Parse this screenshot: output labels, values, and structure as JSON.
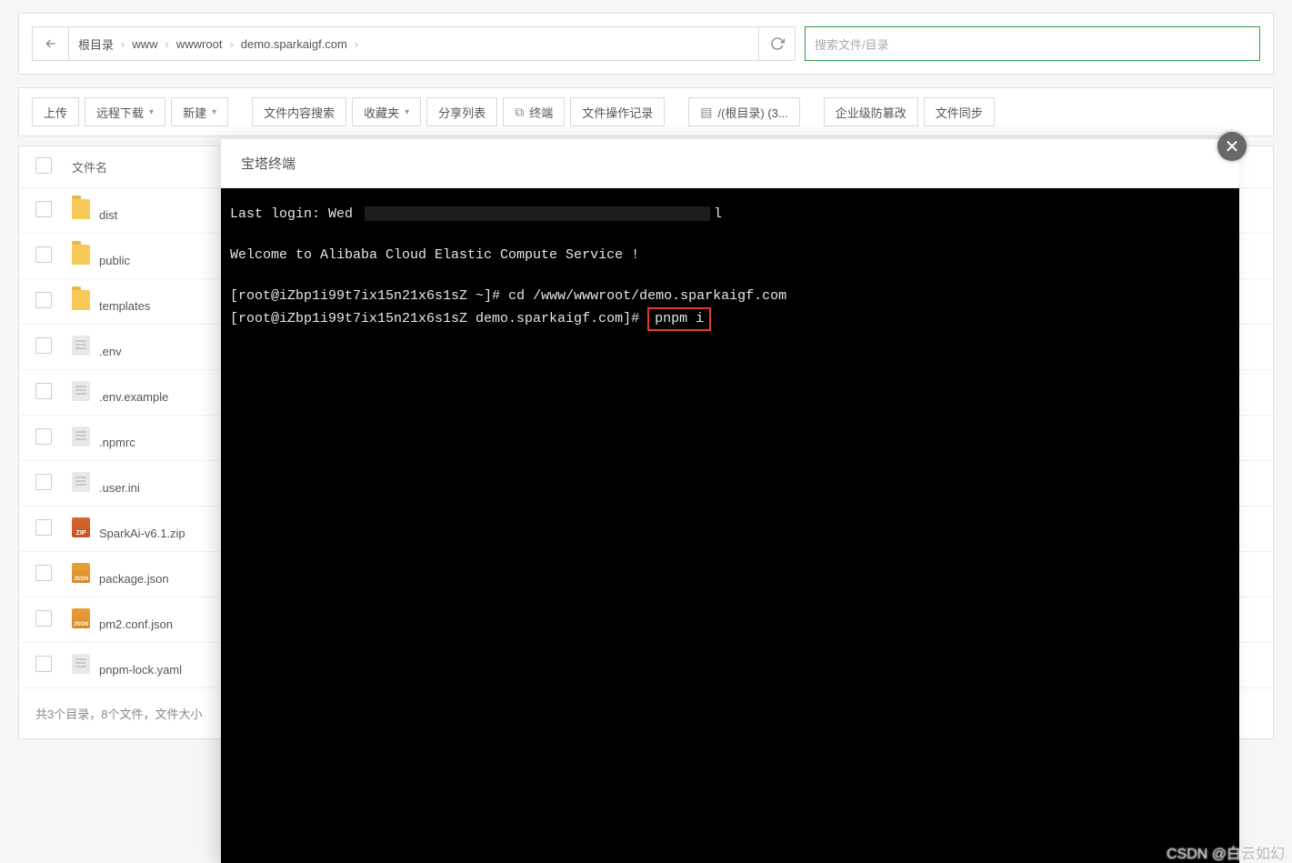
{
  "breadcrumb": {
    "root": "根目录",
    "parts": [
      "www",
      "wwwroot",
      "demo.sparkaigf.com"
    ]
  },
  "search": {
    "placeholder": "搜索文件/目录"
  },
  "toolbar": {
    "upload": "上传",
    "remote_dl": "远程下载",
    "new": "新建",
    "content_search": "文件内容搜索",
    "favorites": "收藏夹",
    "share_list": "分享列表",
    "terminal": "终端",
    "op_log": "文件操作记录",
    "disk": "/(根目录) (3...",
    "tamper": "企业级防篡改",
    "sync": "文件同步"
  },
  "table": {
    "header_name": "文件名"
  },
  "files": [
    {
      "name": "dist",
      "type": "folder"
    },
    {
      "name": "public",
      "type": "folder"
    },
    {
      "name": "templates",
      "type": "folder"
    },
    {
      "name": ".env",
      "type": "file"
    },
    {
      "name": ".env.example",
      "type": "file"
    },
    {
      "name": ".npmrc",
      "type": "file"
    },
    {
      "name": ".user.ini",
      "type": "file"
    },
    {
      "name": "SparkAi-v6.1.zip",
      "type": "zip"
    },
    {
      "name": "package.json",
      "type": "json"
    },
    {
      "name": "pm2.conf.json",
      "type": "json"
    },
    {
      "name": "pnpm-lock.yaml",
      "type": "file"
    }
  ],
  "footer": "共3个目录，8个文件，文件大小",
  "modal": {
    "title": "宝塔终端"
  },
  "terminal": {
    "line1_pre": "Last login: Wed ",
    "line1_post": "l",
    "welcome": "Welcome to Alibaba Cloud Elastic Compute Service !",
    "prompt1": "[root@iZbp1i99t7ix15n21x6s1sZ ~]# ",
    "cmd1": "cd /www/wwwroot/demo.sparkaigf.com",
    "prompt2": "[root@iZbp1i99t7ix15n21x6s1sZ demo.sparkaigf.com]# ",
    "cmd2": "pnpm i"
  },
  "watermark": "CSDN @白云如幻"
}
